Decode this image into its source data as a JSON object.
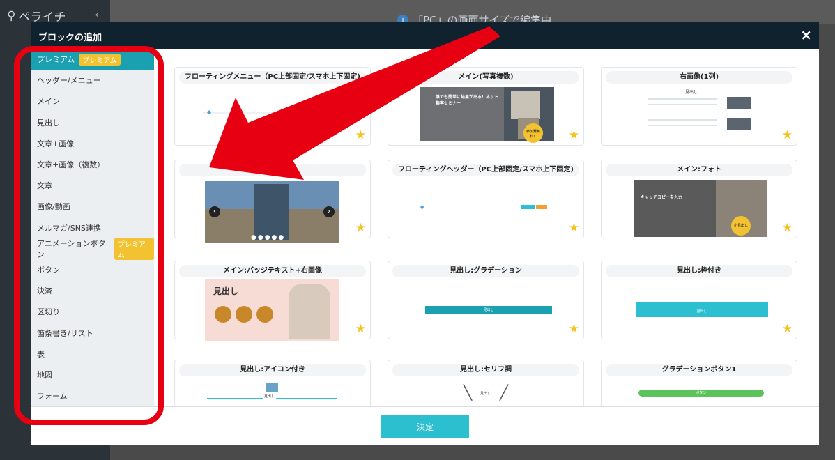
{
  "app": {
    "logo": "ペライチ",
    "collapse_icon": "chevron-left-icon",
    "notice": "「PC」の画面サイズで編集中"
  },
  "modal": {
    "title": "ブロックの追加",
    "close_label": "×",
    "decide_label": "決定"
  },
  "categories": [
    {
      "label": "プレミアム",
      "badge": "プレミアム",
      "active": true
    },
    {
      "label": "ヘッダー/メニュー"
    },
    {
      "label": "メイン"
    },
    {
      "label": "見出し"
    },
    {
      "label": "文章+画像"
    },
    {
      "label": "文章+画像（複数）"
    },
    {
      "label": "文章"
    },
    {
      "label": "画像/動画"
    },
    {
      "label": "メルマガ/SNS連携"
    },
    {
      "label": "アニメーションボタン",
      "badge": "プレミアム"
    },
    {
      "label": "ボタン"
    },
    {
      "label": "決済"
    },
    {
      "label": "区切り"
    },
    {
      "label": "箇条書き/リスト"
    },
    {
      "label": "表"
    },
    {
      "label": "地図"
    },
    {
      "label": "フォーム"
    }
  ],
  "cards": [
    {
      "title": "フローティングメニュー（PC上部固定/スマホ上下固定)"
    },
    {
      "title": "メイン(写真複数)",
      "thumb_text": "誰でも簡単に結果が出る！ネット集客セミナー",
      "thumb_badge": "参加費無料！"
    },
    {
      "title": "右画像(1列)",
      "thumb_text": "見出し"
    },
    {
      "title": ""
    },
    {
      "title": "フローティングヘッダー（PC上部固定/スマホ上下固定)"
    },
    {
      "title": "メイン:フォト",
      "thumb_text": "キャッチコピーを入力",
      "thumb_badge": "小見出し"
    },
    {
      "title": "メイン:バッジテキスト+右画像",
      "thumb_text": "見出し"
    },
    {
      "title": "見出し:グラデーション",
      "thumb_text": "見出し"
    },
    {
      "title": "見出し:枠付き",
      "thumb_text": "見出し"
    },
    {
      "title": "見出し:アイコン付き",
      "thumb_text": "見出し"
    },
    {
      "title": "見出し:セリフ調",
      "thumb_text": "見出し"
    },
    {
      "title": "グラデーションボタン1",
      "thumb_text": "ボタン"
    }
  ],
  "colors": {
    "accent": "#1aa0b0",
    "badge": "#f2c230",
    "annotation": "#e60012",
    "star": "#f4c31b",
    "button": "#2bbfd0"
  }
}
